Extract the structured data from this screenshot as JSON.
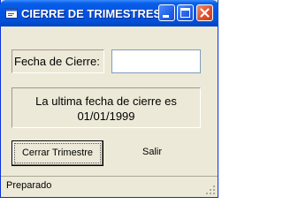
{
  "window": {
    "title": "CIERRE DE TRIMESTRES",
    "icons": {
      "app": "app-form-icon",
      "minimize": "minimize-icon",
      "maximize": "maximize-icon",
      "close": "close-icon"
    }
  },
  "form": {
    "fecha_label": "Fecha de Cierre:",
    "fecha_value": "",
    "info_line1": "La ultima fecha de cierre es",
    "info_line2": "01/01/1999"
  },
  "buttons": {
    "cerrar": "Cerrar Trimestre",
    "salir": "Salir"
  },
  "status": {
    "text": "Preparado"
  },
  "colors": {
    "titlebar": "#0054e3",
    "window_bg": "#ece9d8",
    "close_button": "#e0502e"
  }
}
